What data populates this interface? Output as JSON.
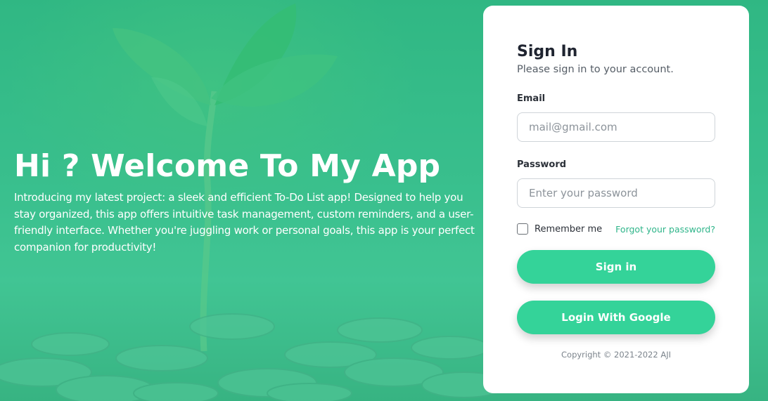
{
  "hero": {
    "title": "Hi ? Welcome To My App",
    "description": "Introducing my latest project: a sleek and efficient To-Do List app! Designed to help you stay organized, this app offers intuitive task management, custom reminders, and a user-friendly interface. Whether you're juggling work or personal goals, this app is your perfect companion for productivity!"
  },
  "signin": {
    "title": "Sign In",
    "subtitle": "Please sign in to your account.",
    "email_label": "Email",
    "email_placeholder": "mail@gmail.com",
    "password_label": "Password",
    "password_placeholder": "Enter your password",
    "remember_label": "Remember me",
    "forgot_label": "Forgot your password?",
    "signin_button": "Sign in",
    "google_button": "Login With Google",
    "copyright": "Copyright © 2021-2022 AJI"
  },
  "colors": {
    "accent": "#34d399",
    "link": "#2fb58a",
    "background": "#3bb58a"
  },
  "icons": {
    "background": "sprout-and-coins-image"
  }
}
